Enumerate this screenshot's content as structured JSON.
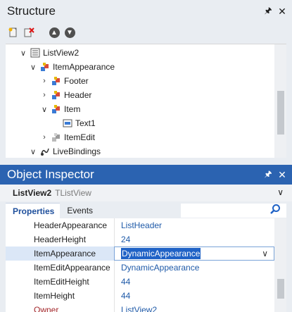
{
  "structure": {
    "title": "Structure",
    "pin_glyph": "🖈",
    "close_glyph": "✕",
    "toolbar": {
      "icons": [
        "new-item-icon",
        "delete-item-icon",
        "move-up-icon",
        "move-down-icon"
      ],
      "up_glyph": "▲",
      "down_glyph": "▼"
    },
    "tree": [
      {
        "label": "ListView2",
        "icon": "listview-icon",
        "expanded": true
      },
      {
        "label": "ItemAppearance",
        "icon": "object-icon",
        "expanded": true
      },
      {
        "label": "Footer",
        "icon": "object-icon",
        "expanded": false
      },
      {
        "label": "Header",
        "icon": "object-icon",
        "expanded": false
      },
      {
        "label": "Item",
        "icon": "object-icon",
        "expanded": true
      },
      {
        "label": "Text1",
        "icon": "text-object-icon"
      },
      {
        "label": "ItemEdit",
        "icon": "object-icon",
        "expanded": false
      },
      {
        "label": "LiveBindings",
        "icon": "livebindings-icon",
        "expanded": true
      }
    ],
    "chevron_expanded": "∨",
    "chevron_collapsed": "›"
  },
  "object_inspector": {
    "title": "Object Inspector",
    "pin_glyph": "🖈",
    "close_glyph": "✕",
    "selected_object": {
      "name": "ListView2",
      "type": "TListView"
    },
    "dropdown_glyph": "∨",
    "tabs": [
      {
        "label": "Properties",
        "active": true
      },
      {
        "label": "Events",
        "active": false
      }
    ],
    "properties": [
      {
        "name": "HeaderAppearance",
        "value": "ListHeader"
      },
      {
        "name": "HeaderHeight",
        "value": "24"
      },
      {
        "name": "ItemAppearance",
        "value": "DynamicAppearance",
        "selected": true
      },
      {
        "name": "ItemEditAppearance",
        "value": "DynamicAppearance"
      },
      {
        "name": "ItemEditHeight",
        "value": "44"
      },
      {
        "name": "ItemHeight",
        "value": "44"
      },
      {
        "name": "Owner",
        "value": "ListView2",
        "highlight": true
      }
    ],
    "colors": {
      "title_bar": "#2b63b1",
      "value_text": "#1f5aa8",
      "owner_name": "#a3272b",
      "selection": "#1f62c6"
    }
  }
}
